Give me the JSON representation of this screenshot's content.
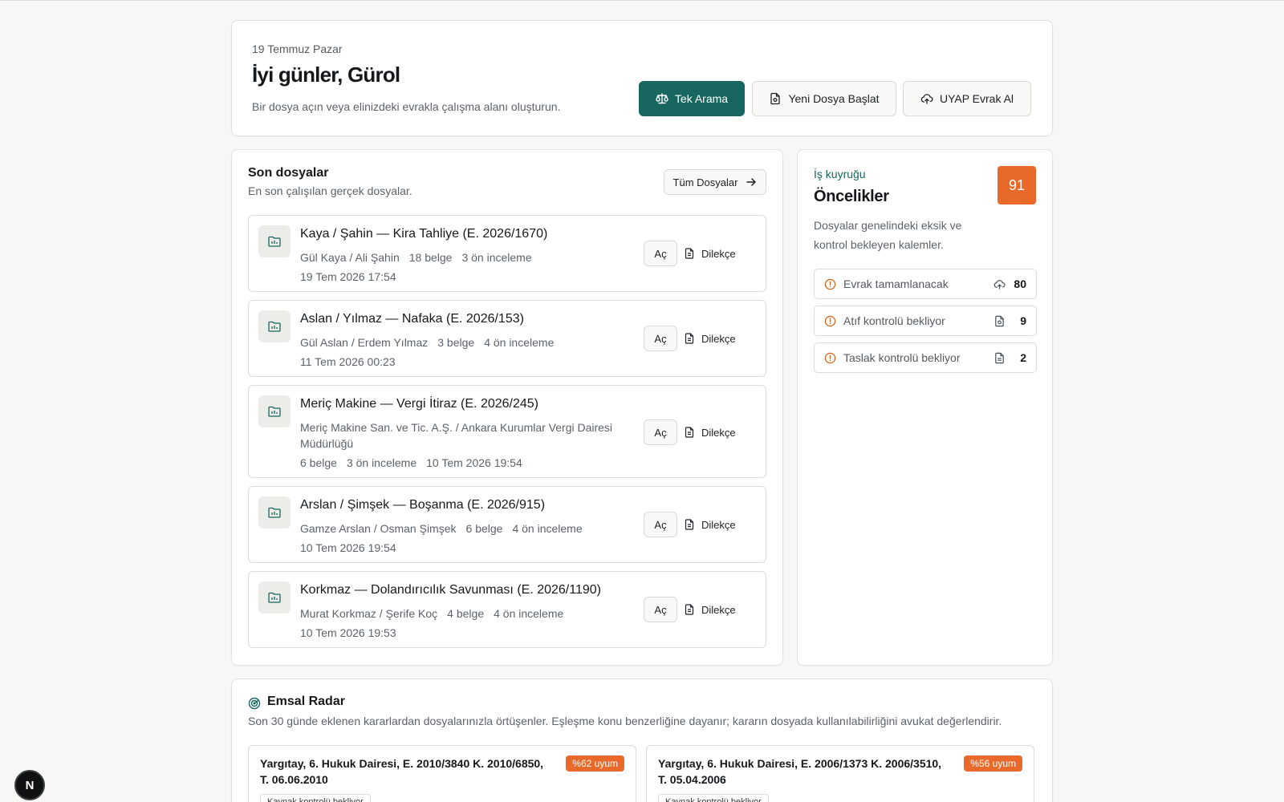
{
  "header": {
    "date": "19 Temmuz Pazar",
    "greeting": "İyi günler, Gürol",
    "subtitle": "Bir dosya açın veya elinizdeki evrakla çalışma alanı oluşturun.",
    "buttons": {
      "search": "Tek Arama",
      "new_file": "Yeni Dosya Başlat",
      "uyap": "UYAP Evrak Al"
    }
  },
  "recent": {
    "title": "Son dosyalar",
    "subtitle": "En son çalışılan gerçek dosyalar.",
    "all_link": "Tüm Dosyalar",
    "open_label": "Aç",
    "petition_label": "Dilekçe",
    "files": [
      {
        "title": "Kaya / Şahin — Kira Tahliye (E. 2026/1670)",
        "parties": "Gül Kaya / Ali Şahin",
        "docs": "18 belge",
        "review": "3 ön inceleme",
        "date": "19 Tem 2026 17:54"
      },
      {
        "title": "Aslan / Yılmaz — Nafaka (E. 2026/153)",
        "parties": "Gül Aslan / Erdem Yılmaz",
        "docs": "3 belge",
        "review": "4 ön inceleme",
        "date": "11 Tem 2026 00:23"
      },
      {
        "title": "Meriç Makine — Vergi İtiraz (E. 2026/245)",
        "parties": "Meriç Makine San. ve Tic. A.Ş. / Ankara Kurumlar Vergi Dairesi Müdürlüğü",
        "docs": "6 belge",
        "review": "3 ön inceleme",
        "date": "10 Tem 2026 19:54"
      },
      {
        "title": "Arslan / Şimşek — Boşanma (E. 2026/915)",
        "parties": "Gamze Arslan / Osman Şimşek",
        "docs": "6 belge",
        "review": "4 ön inceleme",
        "date": "10 Tem 2026 19:54"
      },
      {
        "title": "Korkmaz — Dolandırıcılık Savunması (E. 2026/1190)",
        "parties": "Murat Korkmaz / Şerife Koç",
        "docs": "4 belge",
        "review": "4 ön inceleme",
        "date": "10 Tem 2026 19:53"
      }
    ]
  },
  "queue": {
    "kicker": "İş kuyruğu",
    "title": "Öncelikler",
    "count": "91",
    "description": "Dosyalar genelindeki eksik ve kontrol bekleyen kalemler.",
    "items": [
      {
        "label": "Evrak tamamlanacak",
        "icon": "upload-cloud-icon",
        "value": "80"
      },
      {
        "label": "Atıf kontrolü bekliyor",
        "icon": "file-refresh-icon",
        "value": "9"
      },
      {
        "label": "Taslak kontrolü bekliyor",
        "icon": "document-icon",
        "value": "2"
      }
    ]
  },
  "radar": {
    "title": "Emsal Radar",
    "subtitle": "Son 30 günde eklenen kararlardan dosyalarınızla örtüşenler. Eşleşme konu benzerliğine dayanır; kararın dosyada kullanılabilirliğini avukat değerlendirir.",
    "items": [
      {
        "title": "Yargıtay, 6. Hukuk Dairesi, E. 2010/3840 K. 2010/6850, T. 06.06.2010",
        "match": "%62 uyum",
        "tag": "Kaynak kontrolü bekliyor"
      },
      {
        "title": "Yargıtay, 6. Hukuk Dairesi, E. 2006/1373 K. 2006/3510, T. 05.04.2006",
        "match": "%56 uyum",
        "tag": "Kaynak kontrolü bekliyor"
      }
    ]
  },
  "dev_badge": "N",
  "colors": {
    "accent": "#17665f",
    "orange": "#e8692a",
    "background": "#f7f7f6"
  }
}
